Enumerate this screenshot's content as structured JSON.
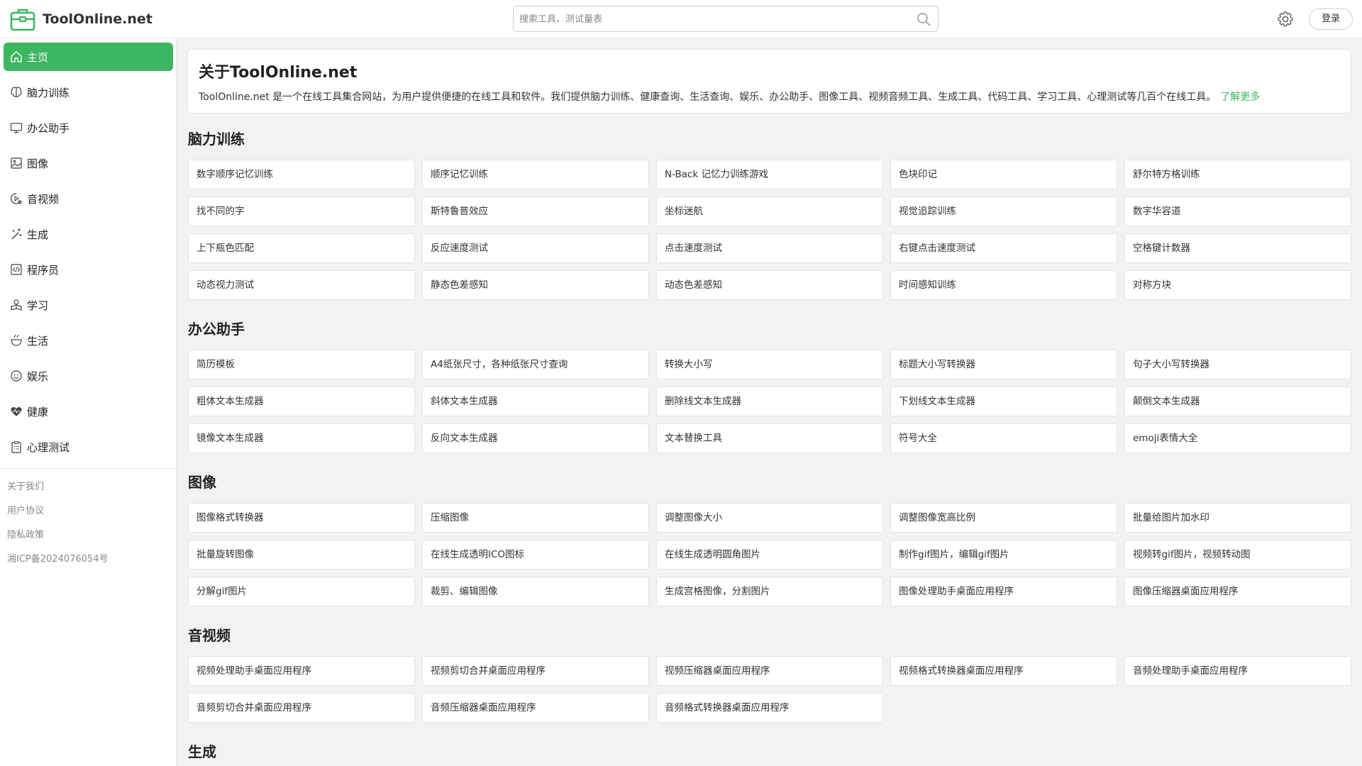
{
  "header": {
    "site_name": "ToolOnline.net",
    "search_placeholder": "搜索工具、测试量表",
    "login_label": "登录",
    "accent_color": "#3cb660"
  },
  "sidebar": {
    "items": [
      {
        "label": "主页",
        "icon": "home-icon",
        "active": true
      },
      {
        "label": "脑力训练",
        "icon": "brain-icon"
      },
      {
        "label": "办公助手",
        "icon": "monitor-icon"
      },
      {
        "label": "图像",
        "icon": "image-icon"
      },
      {
        "label": "音视频",
        "icon": "media-icon"
      },
      {
        "label": "生成",
        "icon": "magic-wand-icon"
      },
      {
        "label": "程序员",
        "icon": "code-icon"
      },
      {
        "label": "学习",
        "icon": "learning-icon"
      },
      {
        "label": "生活",
        "icon": "life-icon"
      },
      {
        "label": "娱乐",
        "icon": "smile-icon"
      },
      {
        "label": "健康",
        "icon": "heart-icon"
      },
      {
        "label": "心理测试",
        "icon": "clipboard-icon"
      }
    ],
    "footer_links": [
      "关于我们",
      "用户协议",
      "隐私政策",
      "湘ICP备2024076054号"
    ]
  },
  "about": {
    "title": "关于ToolOnline.net",
    "text": "ToolOnline.net 是一个在线工具集合网站，为用户提供便捷的在线工具和软件。我们提供脑力训练、健康查询、生活查询、娱乐、办公助手、图像工具、视频音频工具、生成工具、代码工具、学习工具、心理测试等几百个在线工具。",
    "more_label": "了解更多"
  },
  "sections": [
    {
      "title": "脑力训练",
      "tools": [
        "数字顺序记忆训练",
        "顺序记忆训练",
        "N-Back 记忆力训练游戏",
        "色块印记",
        "舒尔特方格训练",
        "找不同的字",
        "斯特鲁普效应",
        "坐标迷航",
        "视觉追踪训练",
        "数字华容道",
        "上下瓶色匹配",
        "反应速度测试",
        "点击速度测试",
        "右键点击速度测试",
        "空格键计数器",
        "动态视力测试",
        "静态色差感知",
        "动态色差感知",
        "时间感知训练",
        "对称方块"
      ]
    },
    {
      "title": "办公助手",
      "tools": [
        "简历模板",
        "A4纸张尺寸，各种纸张尺寸查询",
        "转换大小写",
        "标题大小写转换器",
        "句子大小写转换器",
        "粗体文本生成器",
        "斜体文本生成器",
        "删除线文本生成器",
        "下划线文本生成器",
        "颠倒文本生成器",
        "镜像文本生成器",
        "反向文本生成器",
        "文本替换工具",
        "符号大全",
        "emoji表情大全"
      ]
    },
    {
      "title": "图像",
      "tools": [
        "图像格式转换器",
        "压缩图像",
        "调整图像大小",
        "调整图像宽高比例",
        "批量给图片加水印",
        "批量旋转图像",
        "在线生成透明ICO图标",
        "在线生成透明圆角图片",
        "制作gif图片，编辑gif图片",
        "视频转gif图片，视频转动图",
        "分解gif图片",
        "裁剪、编辑图像",
        "生成宫格图像，分割图片",
        "图像处理助手桌面应用程序",
        "图像压缩器桌面应用程序"
      ]
    },
    {
      "title": "音视频",
      "tools": [
        "视频处理助手桌面应用程序",
        "视频剪切合并桌面应用程序",
        "视频压缩器桌面应用程序",
        "视频格式转换器桌面应用程序",
        "音频处理助手桌面应用程序",
        "音频剪切合并桌面应用程序",
        "音频压缩器桌面应用程序",
        "音频格式转换器桌面应用程序"
      ]
    },
    {
      "title": "生成",
      "tools": []
    }
  ]
}
